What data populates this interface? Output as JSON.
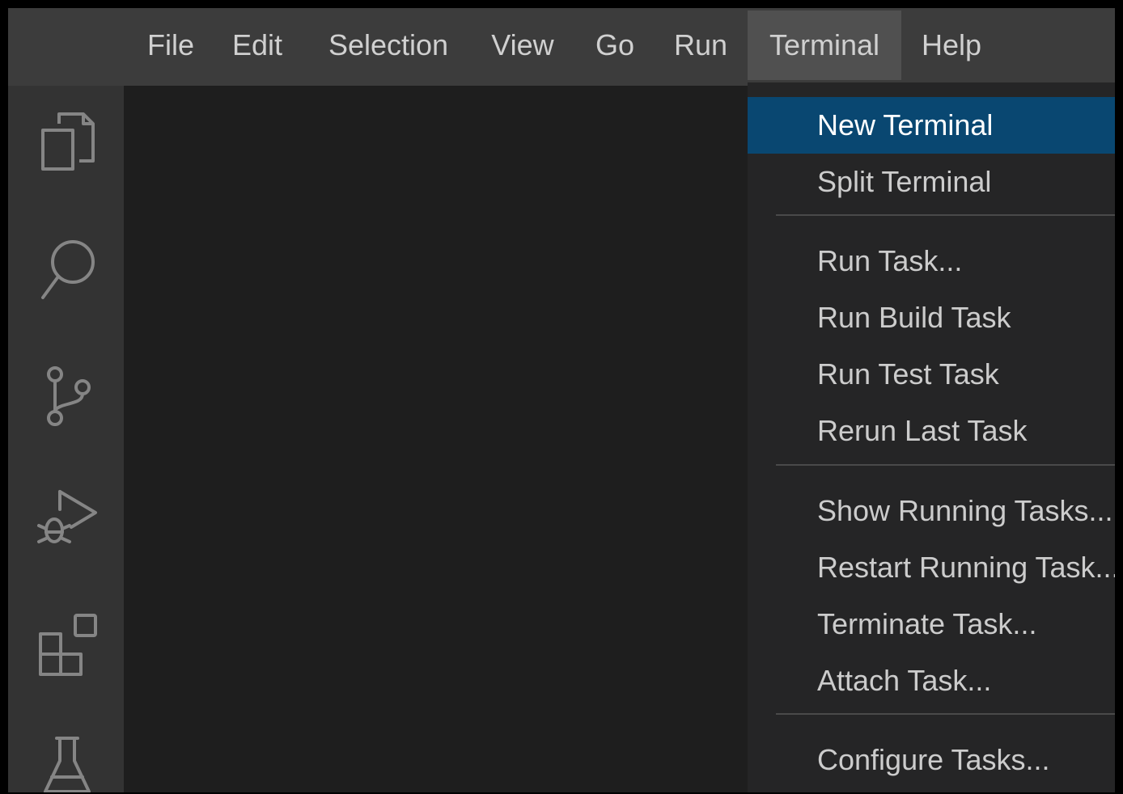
{
  "menubar": {
    "items": [
      "File",
      "Edit",
      "Selection",
      "View",
      "Go",
      "Run",
      "Terminal",
      "Help"
    ],
    "active": "Terminal"
  },
  "activitybar": {
    "icons": [
      "files-icon",
      "search-icon",
      "source-control-icon",
      "run-debug-icon",
      "extensions-icon",
      "testing-icon"
    ]
  },
  "terminal_menu": {
    "items": [
      "New Terminal",
      "Split Terminal",
      "Run Task...",
      "Run Build Task",
      "Run Test Task",
      "Rerun Last Task",
      "Show Running Tasks...",
      "Restart Running Task...",
      "Terminate Task...",
      "Attach Task...",
      "Configure Tasks..."
    ],
    "highlighted": "New Terminal"
  },
  "colors": {
    "menubar_bg": "#3c3c3c",
    "activitybar_bg": "#333333",
    "editor_bg": "#1e1e1e",
    "dropdown_bg": "#252526",
    "highlight": "#094771"
  }
}
